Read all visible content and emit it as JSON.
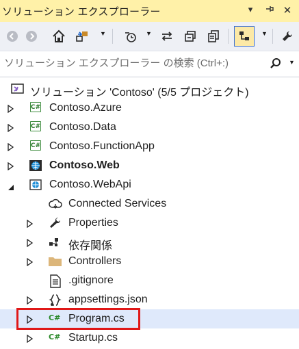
{
  "window": {
    "title": "ソリューション エクスプローラー"
  },
  "search": {
    "placeholder": "ソリューション エクスプローラー の検索 (Ctrl+:)"
  },
  "solution": {
    "label": "ソリューション 'Contoso' (5/5 プロジェクト)"
  },
  "tree": {
    "azure": "Contoso.Azure",
    "data": "Contoso.Data",
    "functionapp": "Contoso.FunctionApp",
    "web": "Contoso.Web",
    "webapi": "Contoso.WebApi",
    "connected_services": "Connected Services",
    "properties": "Properties",
    "dependencies": "依存関係",
    "controllers": "Controllers",
    "gitignore": ".gitignore",
    "appsettings": "appsettings.json",
    "program": "Program.cs",
    "startup": "Startup.cs"
  },
  "colors": {
    "titlebar": "#fff1a8",
    "toolbar": "#eef0f5",
    "selection": "#dfe9fb",
    "highlight_border": "#e01818",
    "csharp_green": "#3c8b3c"
  },
  "icons": [
    "back-icon",
    "forward-icon",
    "home-icon",
    "switch-view-icon",
    "pending-changes-icon",
    "sync-icon",
    "collapse-all-icon",
    "copy-icon",
    "preview-icon",
    "search-icon",
    "pin-icon",
    "close-icon"
  ]
}
